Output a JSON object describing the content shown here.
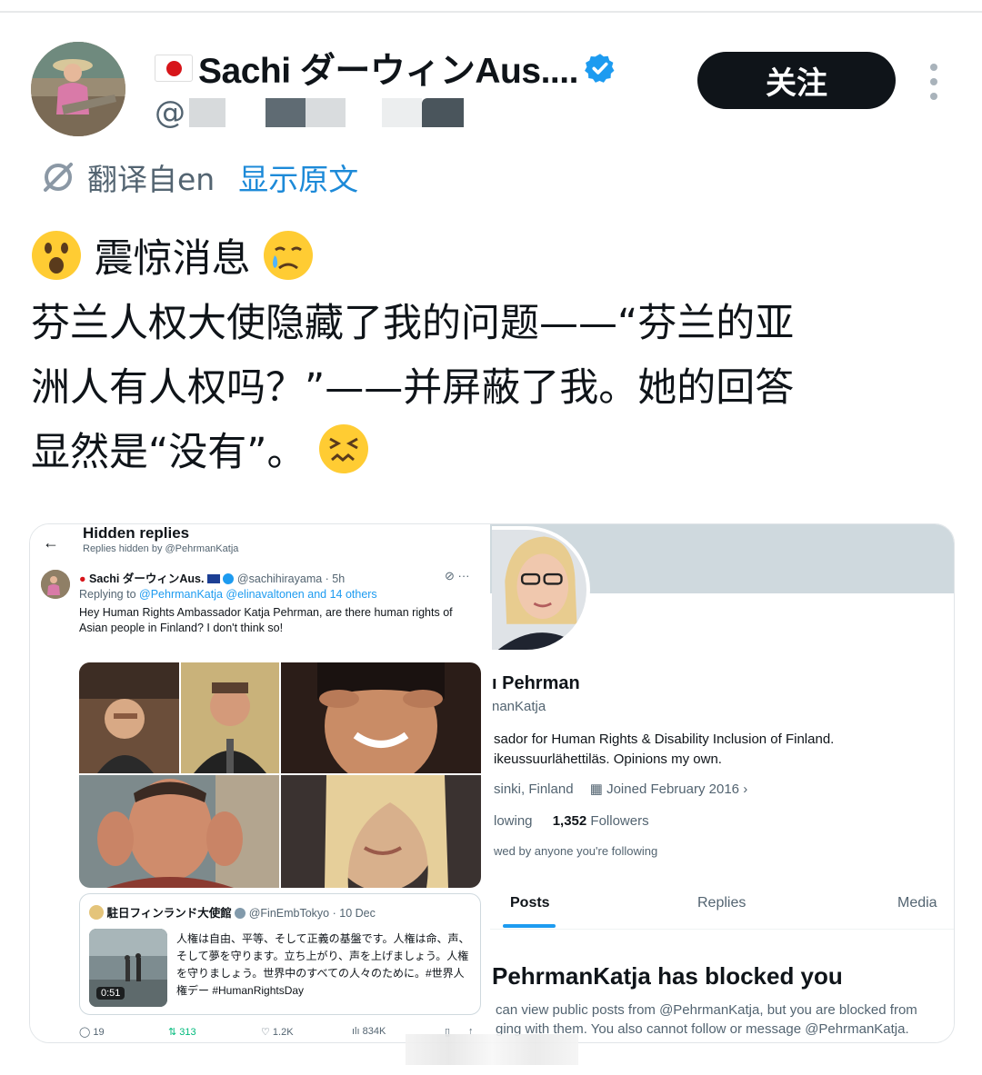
{
  "tweet": {
    "display_name": "Sachi ダーウィンAus....",
    "handle_prefix": "@",
    "follow_label": "关注",
    "translated_from": "翻译自en",
    "show_original": "显示原文",
    "text_line1": "震惊消息",
    "text_line2": "芬兰人权大使隐藏了我的问题——“芬兰的亚",
    "text_line3": "洲人有人权吗？”——并屏蔽了我。她的回答",
    "text_line4": "显然是“没有”。"
  },
  "screenshot": {
    "hidden_replies_title": "Hidden replies",
    "hidden_replies_sub": "Replies hidden by @PehrmanKatja",
    "reply_author": "Sachi ダーウィンAus.",
    "reply_meta": "@sachihirayama · 5h",
    "replying_to": "Replying to",
    "replying_mentions": "@PehrmanKatja @elinavaltonen and 14 others",
    "reply_body": "Hey Human Rights Ambassador Katja Pehrman, are there human rights of Asian people in Finland? I don't think so!",
    "quote_author": "駐日フィンランド大使館",
    "quote_meta": "@FinEmbTokyo · 10 Dec",
    "quote_text": "人権は自由、平等、そして正義の基盤です。人権は命、声、そして夢を守ります。立ち上がり、声を上げましょう。人権を守りましょう。世界中のすべての人々のために。#世界人権デー #HumanRightsDay",
    "video_duration": "0:51",
    "replies_count": "19",
    "retweets_count": "313",
    "likes_count": "1.2K",
    "views_count": "834K"
  },
  "profile": {
    "name_partial": "ı Pehrman",
    "handle_partial": "nanKatja",
    "bio_line1": "sador for Human Rights & Disability Inclusion of Finland.",
    "bio_line2": "ikeussuurlähettiläs. Opinions my own.",
    "location": "sinki, Finland",
    "joined": "Joined February 2016",
    "following_partial": "lowing",
    "followers_count": "1,352",
    "followers_label": "Followers",
    "followed_by": "wed by anyone you're following",
    "tab_posts": "Posts",
    "tab_replies": "Replies",
    "tab_media": "Media",
    "blocked_title": "PehrmanKatja has blocked you",
    "blocked_line1": "can view public posts from @PehrmanKatja, but you are blocked from",
    "blocked_line2": "ging with them. You also cannot follow or message @PehrmanKatja."
  },
  "colors": {
    "accent": "#1d9bf0",
    "link": "#1d8ad8",
    "text": "#0f1419",
    "muted": "#536471",
    "follow_bg": "#0f1419",
    "retweet": "#00ba7c"
  },
  "icons": [
    "flag-japan-icon",
    "verified-badge-icon",
    "more-icon",
    "translate-icon",
    "astonished-face-emoji",
    "crying-face-emoji",
    "confounded-face-emoji",
    "back-arrow-icon",
    "reply-icon",
    "retweet-icon",
    "like-icon",
    "views-icon",
    "calendar-icon"
  ]
}
